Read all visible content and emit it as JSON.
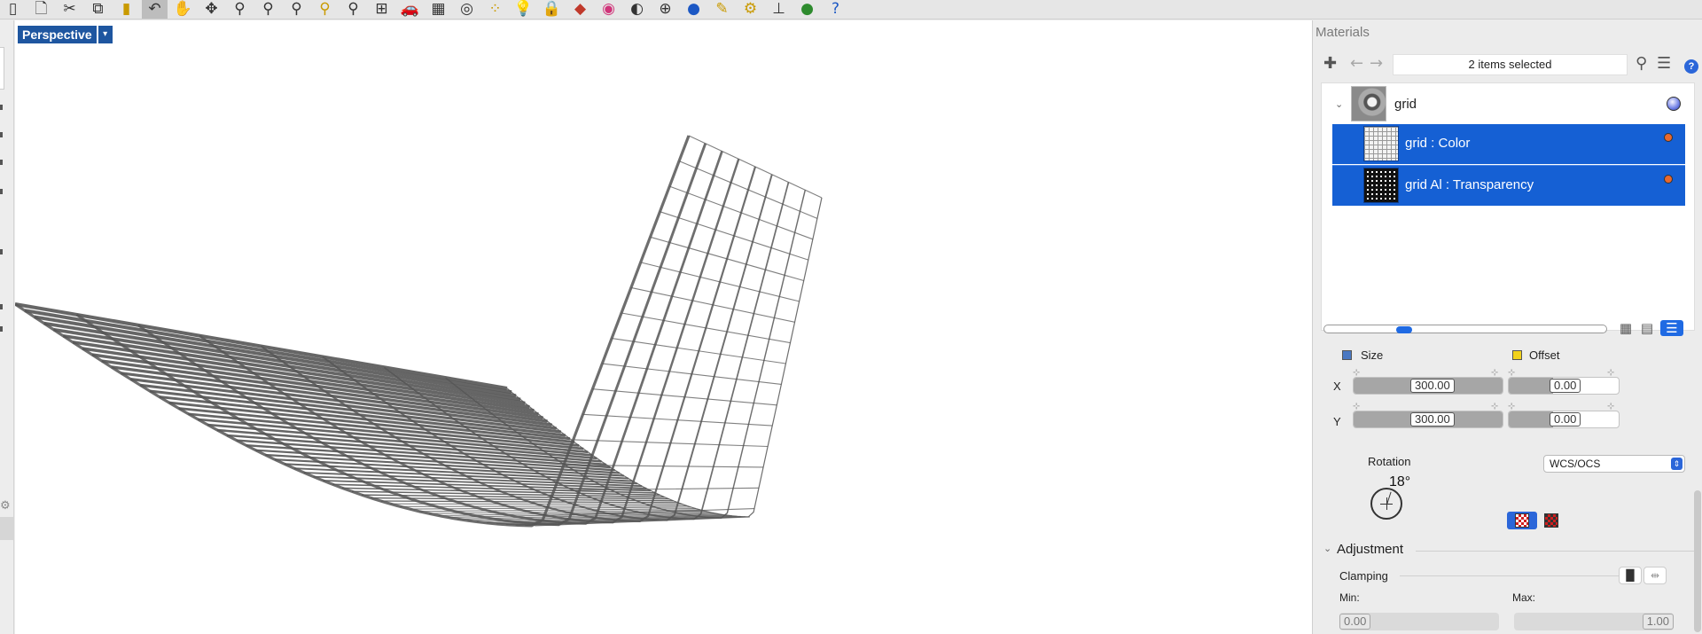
{
  "toolbar": {
    "icons": [
      "page-icon",
      "new-icon",
      "cut-icon",
      "copy-icon",
      "paste-icon",
      "undo-icon",
      "pan-hand-icon",
      "rotate-view-icon",
      "zoom-dynamic-icon",
      "zoom-window-icon",
      "zoom-extents-icon",
      "zoom-selected-icon",
      "zoom-target-icon",
      "four-viewports-icon",
      "car-icon",
      "grid-plane-icon",
      "ortho-icon",
      "points-icon",
      "light-icon",
      "lock-icon",
      "layers-icon",
      "color-wheel-icon",
      "shaded-sphere-icon",
      "wire-sphere-icon",
      "render-sphere-icon",
      "pencil-icon",
      "gear-icon",
      "hierarchy-icon",
      "globe-icon",
      "help-icon"
    ]
  },
  "viewport": {
    "title": "Perspective",
    "menu_arrow": "▾"
  },
  "panel": {
    "title": "Materials",
    "selection_text": "2 items selected",
    "help_glyph": "?",
    "tree": {
      "parent_label": "grid",
      "children": [
        {
          "label": "grid : Color"
        },
        {
          "label": "grid Al : Transparency"
        }
      ]
    },
    "thumbnail_size_fraction": 0.27,
    "size": {
      "label": "Size",
      "x_label": "X",
      "y_label": "Y",
      "x_value": "300.00",
      "y_value": "300.00",
      "swatch_color": "#4a78c2"
    },
    "offset": {
      "label": "Offset",
      "x_value": "0.00",
      "y_value": "0.00",
      "swatch_color": "#f2d21c"
    },
    "rotation": {
      "label": "Rotation",
      "value": "18°",
      "mode": "WCS/OCS"
    },
    "adjustment": {
      "title": "Adjustment",
      "clamping_label": "Clamping",
      "min_label": "Min:",
      "max_label": "Max:",
      "min_value": "0.00",
      "max_value": "1.00"
    }
  },
  "colors": {
    "selection_blue": "#1560d4",
    "viewport_tab": "#1e56a0",
    "accent": "#1f6ae3"
  }
}
